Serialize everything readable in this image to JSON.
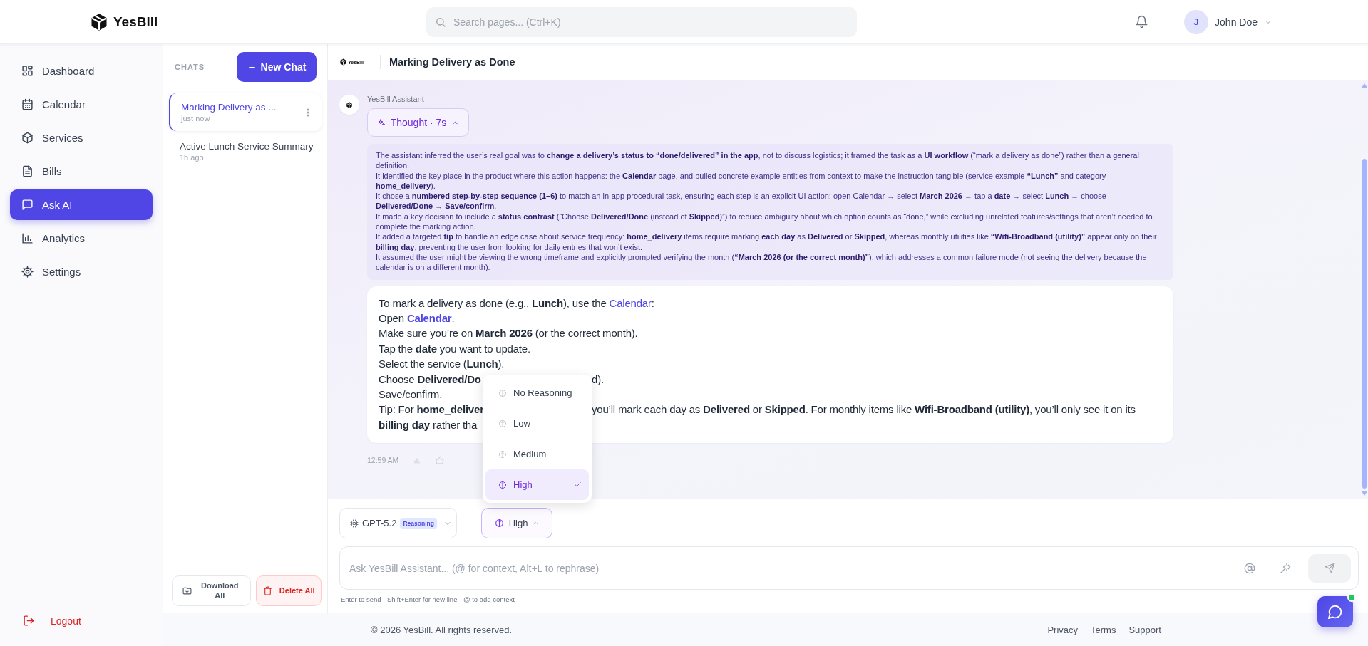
{
  "header": {
    "brand": "YesBill",
    "search": {
      "placeholder": "Search pages... (Ctrl+K)"
    },
    "user": {
      "initial": "J",
      "name": "John Doe"
    }
  },
  "sidebar": {
    "items": [
      {
        "label": "Dashboard",
        "selected": false
      },
      {
        "label": "Calendar",
        "selected": false
      },
      {
        "label": "Services",
        "selected": false
      },
      {
        "label": "Bills",
        "selected": false
      },
      {
        "label": "Ask AI",
        "selected": true
      },
      {
        "label": "Analytics",
        "selected": false
      },
      {
        "label": "Settings",
        "selected": false
      }
    ],
    "logout": "Logout"
  },
  "chats": {
    "heading": "CHATS",
    "new_chat": "New Chat",
    "items": [
      {
        "title": "Marking Delivery as ...",
        "time": "just now",
        "selected": true
      },
      {
        "title": "Active Lunch Service Summary",
        "time": "1h ago",
        "selected": false
      }
    ],
    "download": "Download All",
    "delete": "Delete All"
  },
  "conversation": {
    "brand": "YesBill",
    "title": "Marking Delivery as Done",
    "sender": "YesBill Assistant",
    "thought": {
      "label": "Thought · 7s",
      "expanded": true,
      "paragraphs": [
        "The assistant inferred the user’s real goal was to **change a delivery’s status to “done/delivered” in the app**, not to discuss logistics; it framed the task as a **UI workflow** (“mark a delivery as done”) rather than a general definition.",
        "It identified the key place in the product where this action happens: the **Calendar** page, and pulled concrete example entities from context to make the instruction tangible (service example **“Lunch”** and category **home_delivery**).",
        "It chose a **numbered step-by-step sequence (1–6)** to match an in-app procedural task, ensuring each step is an explicit UI action: open Calendar → select **March 2026** → tap a **date** → select **Lunch** → choose **Delivered/Done** → **Save/confirm**.",
        "It made a key decision to include a **status contrast** (“Choose **Delivered/Done** (instead of **Skipped**)”) to reduce ambiguity about which option counts as “done,” while excluding unrelated features/settings that aren’t needed to complete the marking action.",
        "It added a targeted **tip** to handle an edge case about service frequency: **home_delivery** items require marking **each day** as **Delivered** or **Skipped**, whereas monthly utilities like **“Wifi-Broadband (utility)”** appear only on their **billing day**, preventing the user from looking for daily entries that won’t exist.",
        "It assumed the user might be viewing the wrong timeframe and explicitly prompted verifying the month (**“March 2026 (or the correct month)”**), which addresses a common failure mode (not seeing the delivery because the calendar is on a different month)."
      ]
    },
    "answer": {
      "lines": [
        {
          "parts": [
            {
              "kind": "text",
              "text": "To mark a delivery as done (e.g., **Lunch**), use the "
            },
            {
              "kind": "link",
              "text": "Calendar",
              "bold": false
            },
            {
              "kind": "text",
              "text": ":"
            }
          ]
        },
        {
          "parts": [
            {
              "kind": "text",
              "text": "Open "
            },
            {
              "kind": "link",
              "text": "Calendar",
              "bold": true
            },
            {
              "kind": "text",
              "text": "."
            }
          ]
        },
        {
          "parts": [
            {
              "kind": "text",
              "text": "Make sure you’re on **March 2026** (or the correct month)."
            }
          ]
        },
        {
          "parts": [
            {
              "kind": "text",
              "text": "Tap the **date** you want to update."
            }
          ]
        },
        {
          "parts": [
            {
              "kind": "text",
              "text": "Select the service (**Lunch**)."
            }
          ]
        },
        {
          "parts": [
            {
              "kind": "text",
              "text": "Choose **Delivered/Do**"
            }
          ],
          "after_overlay": "d)."
        },
        {
          "parts": [
            {
              "kind": "text",
              "text": "Save/confirm."
            }
          ]
        },
        {
          "parts": [
            {
              "kind": "text",
              "text": "Tip: For **home_deliver**"
            }
          ],
          "after_overlay": "you’ll mark each day as **Delivered** or **Skipped**. For monthly items like **Wifi-Broadband (utility)**, you’ll only see it on its"
        },
        {
          "parts": [
            {
              "kind": "text",
              "text": "**billing day** rather tha"
            }
          ]
        }
      ]
    },
    "time": "12:59 AM"
  },
  "composer": {
    "model": "GPT-5.2",
    "badge": "Reasoning",
    "effort": {
      "label": "High",
      "open": true,
      "options": [
        {
          "label": "No Reasoning",
          "selected": false
        },
        {
          "label": "Low",
          "selected": false
        },
        {
          "label": "Medium",
          "selected": false
        },
        {
          "label": "High",
          "selected": true
        }
      ]
    },
    "placeholder": "Ask YesBill Assistant... (@ for context, Alt+L to rephrase)",
    "hint": "Enter to send · Shift+Enter for new line · @ to add context"
  },
  "footer": {
    "copyright": "© 2026 YesBill. All rights reserved.",
    "links": [
      "Privacy",
      "Terms",
      "Support"
    ]
  }
}
